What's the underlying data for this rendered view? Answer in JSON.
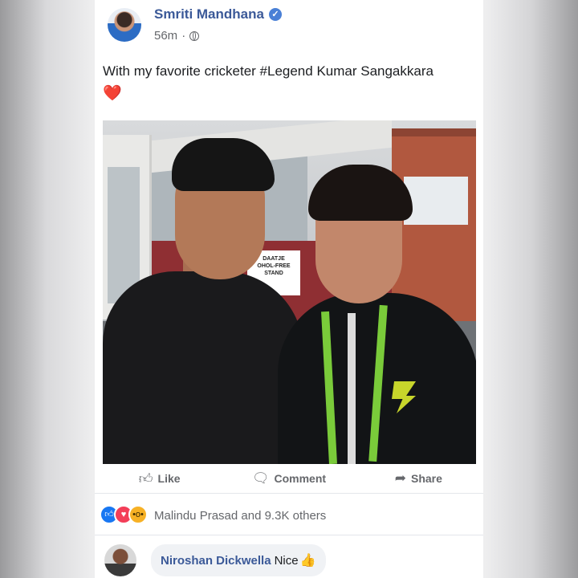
{
  "post": {
    "author": "Smriti Mandhana",
    "verified_icon": "verified-badge-icon",
    "time": "56m",
    "privacy_icon": "globe-icon",
    "text": "With my favorite cricketer #Legend Kumar Sangakkara",
    "emoji": "❤️",
    "photo_sign_text": "DAATJE\nOHOL-FREE\nSTAND"
  },
  "actions": {
    "like": "Like",
    "comment": "Comment",
    "share": "Share"
  },
  "reactions": {
    "icons": [
      "like-reaction-icon",
      "love-reaction-icon",
      "wow-reaction-icon"
    ],
    "summary": "Malindu Prasad and 9.3K others"
  },
  "comment": {
    "author": "Niroshan Dickwella",
    "text": "Nice",
    "emoji": "👍"
  },
  "colors": {
    "author_blue": "#3b5998",
    "like_blue": "#1877f2",
    "love_red": "#f33e58",
    "wow_yellow": "#f7b125"
  }
}
